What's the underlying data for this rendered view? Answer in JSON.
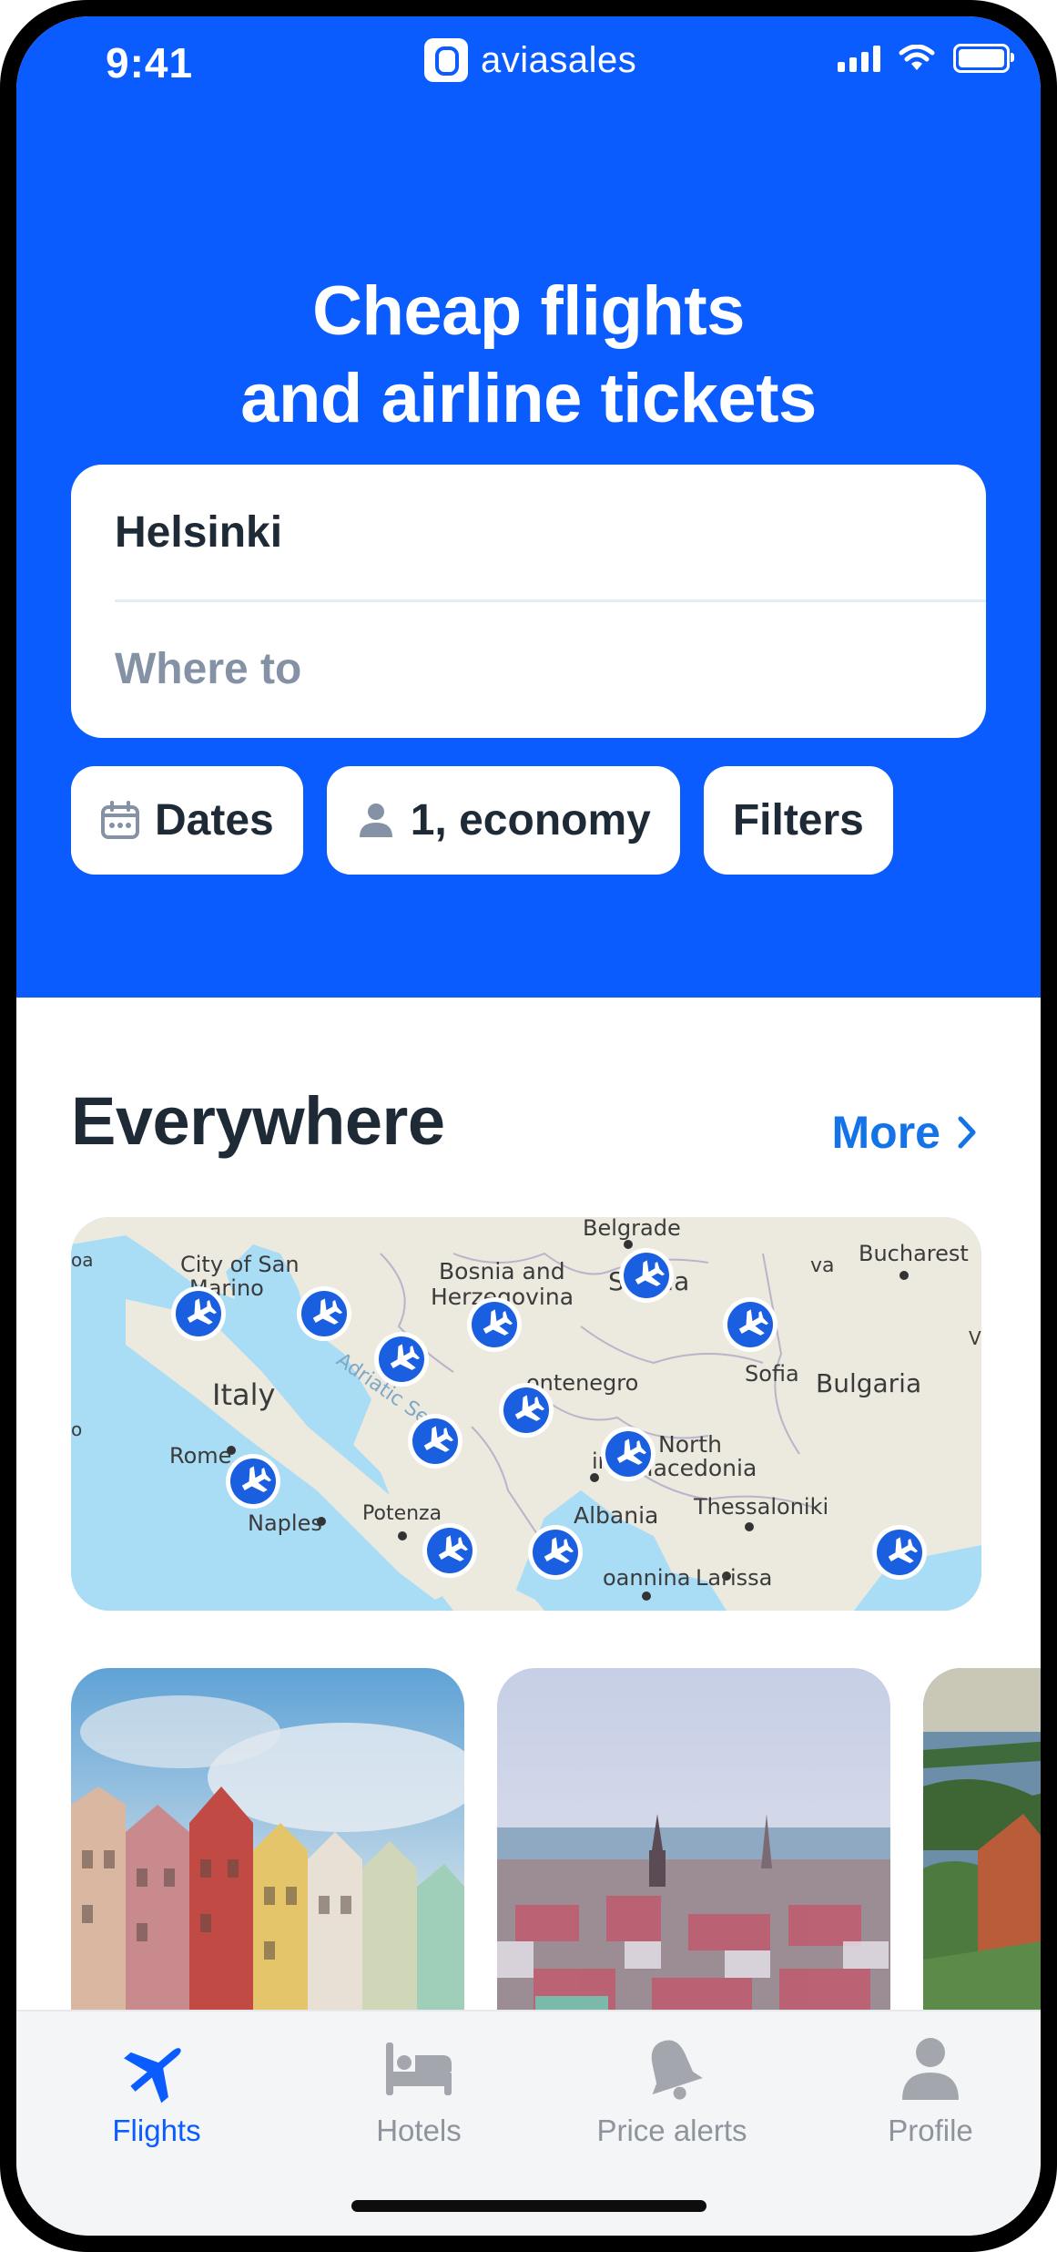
{
  "status_bar": {
    "time": "9:41",
    "brand_name": "aviasales"
  },
  "hero": {
    "headline_line1": "Cheap flights",
    "headline_line2": "and airline tickets"
  },
  "search": {
    "from_value": "Helsinki",
    "to_placeholder": "Where to"
  },
  "chips": {
    "dates": "Dates",
    "passengers": "1, economy",
    "filters": "Filters"
  },
  "section": {
    "title": "Everywhere",
    "more": "More"
  },
  "map": {
    "labels": {
      "belgrade": "Belgrade",
      "bucharest": "Bucharest",
      "san_marino_1": "City of San",
      "san_marino_2": "Marino",
      "bosnia_1": "Bosnia and",
      "bosnia_2": "Herzegovina",
      "serbia": "Serbia",
      "italy": "Italy",
      "adriatic": "Adriatic Sea",
      "montenegro": "ontenegro",
      "sofia": "Sofia",
      "bulgaria": "Bulgaria",
      "rome": "Rome",
      "north_macedonia_1": "North",
      "north_macedonia_2": "Macedonia",
      "tirana": "irana",
      "potenza": "Potenza",
      "naples": "Naples",
      "albania": "Albania",
      "thessaloniki": "Thessaloniki",
      "ioannina": "oannina",
      "larissa": "Larissa",
      "edge_left_1": "oa",
      "edge_left_2": "o",
      "edge_right": "V",
      "edge_va": "va"
    }
  },
  "tabs": [
    {
      "label": "Flights",
      "icon": "airplane-icon",
      "active": true
    },
    {
      "label": "Hotels",
      "icon": "bed-icon",
      "active": false
    },
    {
      "label": "Price alerts",
      "icon": "bell-icon",
      "active": false
    },
    {
      "label": "Profile",
      "icon": "person-icon",
      "active": false
    }
  ],
  "colors": {
    "brand_blue": "#0b5cff",
    "link_blue": "#1473e6",
    "text_dark": "#1f2a37",
    "placeholder": "#8592a6"
  }
}
